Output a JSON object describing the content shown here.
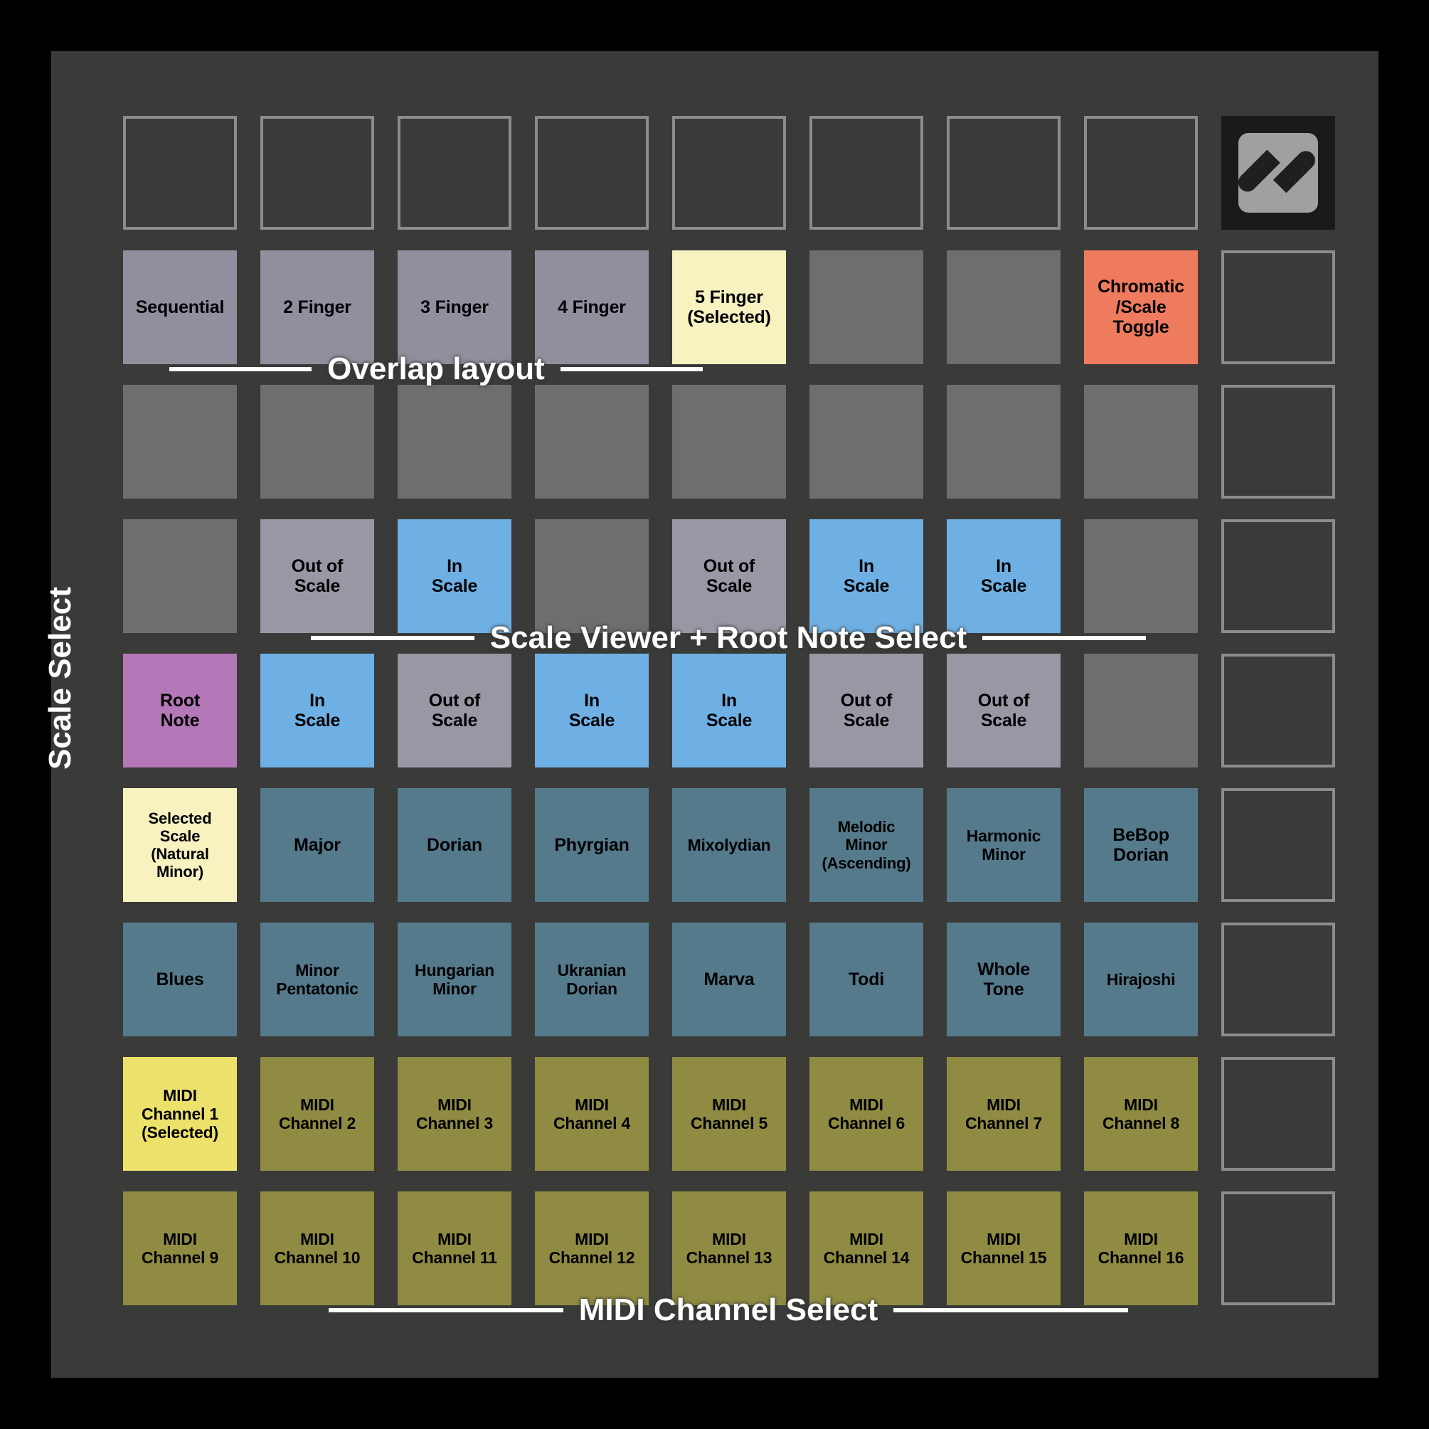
{
  "device": {
    "name": "launchpad-scale-mode-overlay",
    "logo_name": "novation-logo"
  },
  "colors": {
    "body": "#3a3a38",
    "pad_unlit_border": "#8c8c8a",
    "pad_dim": "#6e6e6e",
    "overlap_pad": "#8f8f9e",
    "selected_pale_yellow": "#f7f2c0",
    "chromatic_toggle_red": "#ef7b5e",
    "in_scale_blue": "#6fb0e4",
    "out_of_scale_gray": "#9a97a5",
    "root_note_purple": "#b478b8",
    "scale_teal": "#547a8c",
    "midi_olive": "#8f8b42",
    "midi_selected_yellow": "#ece16b"
  },
  "section_labels": {
    "overlap": "Overlap layout",
    "scale_viewer": "Scale Viewer + Root Note Select",
    "scale_select": "Scale Select",
    "midi_channel": "MIDI Channel Select"
  },
  "rows": [
    {
      "name": "top-function-row",
      "pads": [
        {
          "label": "",
          "style": "off"
        },
        {
          "label": "",
          "style": "off"
        },
        {
          "label": "",
          "style": "off"
        },
        {
          "label": "",
          "style": "off"
        },
        {
          "label": "",
          "style": "off"
        },
        {
          "label": "",
          "style": "off"
        },
        {
          "label": "",
          "style": "off"
        },
        {
          "label": "",
          "style": "off"
        }
      ],
      "right": {
        "label": "",
        "style": "logo"
      }
    },
    {
      "name": "overlap-layout-row",
      "pads": [
        {
          "label": "Sequential",
          "style": "overlap"
        },
        {
          "label": "2 Finger",
          "style": "overlap"
        },
        {
          "label": "3 Finger",
          "style": "overlap"
        },
        {
          "label": "4 Finger",
          "style": "overlap"
        },
        {
          "label": "5 Finger\n(Selected)",
          "style": "selected"
        },
        {
          "label": "",
          "style": "dim"
        },
        {
          "label": "",
          "style": "dim"
        },
        {
          "label": "Chromatic\n/Scale\nToggle",
          "style": "toggle"
        }
      ],
      "right": {
        "label": "",
        "style": "off"
      }
    },
    {
      "name": "blank-dim-row",
      "pads": [
        {
          "label": "",
          "style": "dim"
        },
        {
          "label": "",
          "style": "dim"
        },
        {
          "label": "",
          "style": "dim"
        },
        {
          "label": "",
          "style": "dim"
        },
        {
          "label": "",
          "style": "dim"
        },
        {
          "label": "",
          "style": "dim"
        },
        {
          "label": "",
          "style": "dim"
        },
        {
          "label": "",
          "style": "dim"
        }
      ],
      "right": {
        "label": "",
        "style": "off"
      }
    },
    {
      "name": "scale-viewer-upper-row",
      "pads": [
        {
          "label": "",
          "style": "dim"
        },
        {
          "label": "Out of\nScale",
          "style": "outscale"
        },
        {
          "label": "In\nScale",
          "style": "inscale"
        },
        {
          "label": "",
          "style": "dim"
        },
        {
          "label": "Out of\nScale",
          "style": "outscale"
        },
        {
          "label": "In\nScale",
          "style": "inscale"
        },
        {
          "label": "In\nScale",
          "style": "inscale"
        },
        {
          "label": "",
          "style": "dim"
        }
      ],
      "right": {
        "label": "",
        "style": "off"
      }
    },
    {
      "name": "scale-viewer-lower-row",
      "pads": [
        {
          "label": "Root\nNote",
          "style": "root"
        },
        {
          "label": "In\nScale",
          "style": "inscale"
        },
        {
          "label": "Out of\nScale",
          "style": "outscale"
        },
        {
          "label": "In\nScale",
          "style": "inscale"
        },
        {
          "label": "In\nScale",
          "style": "inscale"
        },
        {
          "label": "Out of\nScale",
          "style": "outscale"
        },
        {
          "label": "Out of\nScale",
          "style": "outscale"
        },
        {
          "label": "",
          "style": "dim"
        }
      ],
      "right": {
        "label": "",
        "style": "off"
      }
    },
    {
      "name": "scale-select-row-1",
      "pads": [
        {
          "label": "Selected\nScale\n(Natural\nMinor)",
          "style": "selected",
          "size": "tiny"
        },
        {
          "label": "Major",
          "style": "scale"
        },
        {
          "label": "Dorian",
          "style": "scale"
        },
        {
          "label": "Phyrgian",
          "style": "scale"
        },
        {
          "label": "Mixolydian",
          "style": "scale",
          "size": "small"
        },
        {
          "label": "Melodic\nMinor\n(Ascending)",
          "style": "scale",
          "size": "tiny"
        },
        {
          "label": "Harmonic\nMinor",
          "style": "scale",
          "size": "small"
        },
        {
          "label": "BeBop\nDorian",
          "style": "scale"
        }
      ],
      "right": {
        "label": "",
        "style": "off"
      }
    },
    {
      "name": "scale-select-row-2",
      "pads": [
        {
          "label": "Blues",
          "style": "scale"
        },
        {
          "label": "Minor\nPentatonic",
          "style": "scale",
          "size": "small"
        },
        {
          "label": "Hungarian\nMinor",
          "style": "scale",
          "size": "small"
        },
        {
          "label": "Ukranian\nDorian",
          "style": "scale",
          "size": "small"
        },
        {
          "label": "Marva",
          "style": "scale"
        },
        {
          "label": "Todi",
          "style": "scale"
        },
        {
          "label": "Whole\nTone",
          "style": "scale"
        },
        {
          "label": "Hirajoshi",
          "style": "scale",
          "size": "small"
        }
      ],
      "right": {
        "label": "",
        "style": "off"
      }
    },
    {
      "name": "midi-channel-row-1",
      "pads": [
        {
          "label": "MIDI\nChannel 1\n(Selected)",
          "style": "midisel",
          "size": "small"
        },
        {
          "label": "MIDI\nChannel 2",
          "style": "midi",
          "size": "small"
        },
        {
          "label": "MIDI\nChannel 3",
          "style": "midi",
          "size": "small"
        },
        {
          "label": "MIDI\nChannel 4",
          "style": "midi",
          "size": "small"
        },
        {
          "label": "MIDI\nChannel 5",
          "style": "midi",
          "size": "small"
        },
        {
          "label": "MIDI\nChannel 6",
          "style": "midi",
          "size": "small"
        },
        {
          "label": "MIDI\nChannel 7",
          "style": "midi",
          "size": "small"
        },
        {
          "label": "MIDI\nChannel 8",
          "style": "midi",
          "size": "small"
        }
      ],
      "right": {
        "label": "",
        "style": "off"
      }
    },
    {
      "name": "midi-channel-row-2",
      "pads": [
        {
          "label": "MIDI\nChannel 9",
          "style": "midi",
          "size": "small"
        },
        {
          "label": "MIDI\nChannel 10",
          "style": "midi",
          "size": "small"
        },
        {
          "label": "MIDI\nChannel 11",
          "style": "midi",
          "size": "small"
        },
        {
          "label": "MIDI\nChannel 12",
          "style": "midi",
          "size": "small"
        },
        {
          "label": "MIDI\nChannel 13",
          "style": "midi",
          "size": "small"
        },
        {
          "label": "MIDI\nChannel 14",
          "style": "midi",
          "size": "small"
        },
        {
          "label": "MIDI\nChannel 15",
          "style": "midi",
          "size": "small"
        },
        {
          "label": "MIDI\nChannel 16",
          "style": "midi",
          "size": "small"
        }
      ],
      "right": {
        "label": "",
        "style": "off"
      }
    }
  ]
}
